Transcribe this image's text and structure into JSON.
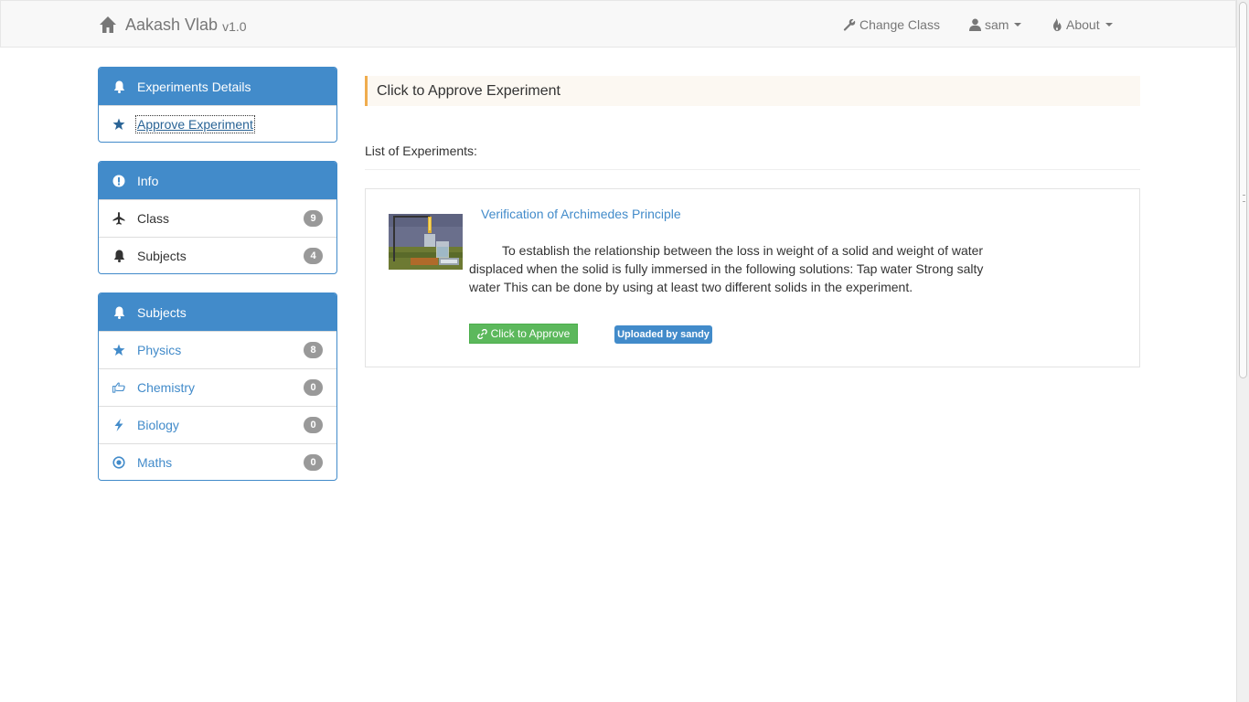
{
  "navbar": {
    "brand": "Aakash Vlab",
    "version": "v1.0",
    "change_class": "Change Class",
    "user": "sam",
    "about": "About"
  },
  "sidebar": {
    "experiments_panel": {
      "heading": "Experiments Details",
      "items": [
        {
          "label": "Approve Experiment",
          "icon": "star-icon"
        }
      ]
    },
    "info_panel": {
      "heading": "Info",
      "items": [
        {
          "label": "Class",
          "count": "9",
          "icon": "plane-icon"
        },
        {
          "label": "Subjects",
          "count": "4",
          "icon": "bell-icon"
        }
      ]
    },
    "subjects_panel": {
      "heading": "Subjects",
      "items": [
        {
          "label": "Physics",
          "count": "8",
          "icon": "star-icon"
        },
        {
          "label": "Chemistry",
          "count": "0",
          "icon": "hand-right-icon"
        },
        {
          "label": "Biology",
          "count": "0",
          "icon": "flash-icon"
        },
        {
          "label": "Maths",
          "count": "0",
          "icon": "record-icon"
        }
      ]
    }
  },
  "main": {
    "alert": "Click to Approve Experiment",
    "list_title": "List of Experiments:",
    "experiments": [
      {
        "title": "Verification of Archimedes Principle",
        "description": "To establish the relationship between the loss in weight of a solid and weight of water displaced when the solid is fully immersed in the following solutions: Tap water Strong salty water This can be done by using at least two different solids in the experiment.",
        "approve_label": "Click to Approve",
        "uploaded_by": "Uploaded by sandy"
      }
    ]
  },
  "colors": {
    "primary": "#428bca",
    "success": "#5cb85c",
    "warning": "#f0ad4e",
    "badge": "#999999"
  }
}
